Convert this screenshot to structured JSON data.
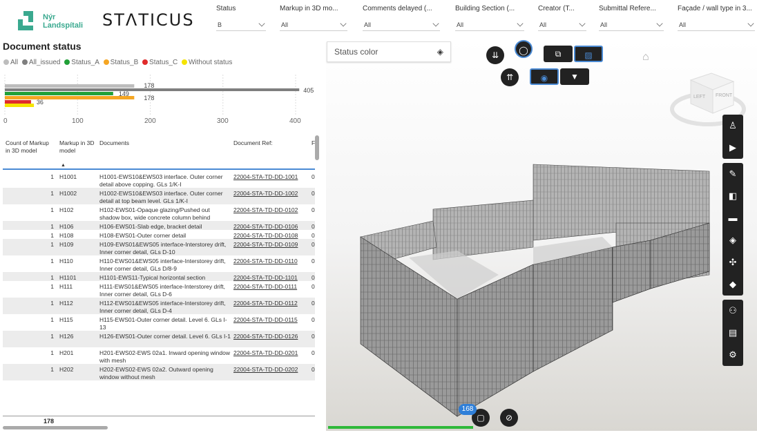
{
  "header": {
    "logo_text_1": "Nýr",
    "logo_text_2": "Landspítali",
    "brand": "STΛTICUS",
    "slicers": [
      {
        "label": "Status",
        "value": "B"
      },
      {
        "label": "Markup in 3D mo...",
        "value": "All"
      },
      {
        "label": "Comments delayed (...",
        "value": "All"
      },
      {
        "label": "Building Section (...",
        "value": "All"
      },
      {
        "label": "Creator (T...",
        "value": "All"
      },
      {
        "label": "Submittal Refere...",
        "value": "All"
      },
      {
        "label": "Façade / wall type in 3...",
        "value": "All"
      }
    ]
  },
  "document_status": {
    "title": "Document status",
    "legend": [
      {
        "label": "All",
        "color": "#bdbdbd"
      },
      {
        "label": "All_issued",
        "color": "#7f7f7f"
      },
      {
        "label": "Status_A",
        "color": "#21a038"
      },
      {
        "label": "Status_B",
        "color": "#f5a623"
      },
      {
        "label": "Status_C",
        "color": "#e02b2b"
      },
      {
        "label": "Without status",
        "color": "#f5e400"
      }
    ]
  },
  "chart_data": {
    "type": "bar",
    "orientation": "horizontal",
    "series": [
      {
        "name": "All",
        "value": 178,
        "color": "#bdbdbd"
      },
      {
        "name": "All_issued",
        "value": 405,
        "color": "#7f7f7f"
      },
      {
        "name": "Status_A",
        "value": 149,
        "color": "#21a038"
      },
      {
        "name": "Status_B",
        "value": 178,
        "color": "#f5a623"
      },
      {
        "name": "Status_C",
        "value": 36,
        "color": "#e02b2b"
      },
      {
        "name": "Without status",
        "value": 40,
        "color": "#f5e400"
      }
    ],
    "data_labels": [
      "178",
      "405",
      "149",
      "178",
      "36"
    ],
    "xlim": [
      0,
      420
    ],
    "x_ticks": [
      "0",
      "100",
      "200",
      "300",
      "400"
    ]
  },
  "table": {
    "headers": [
      "Count of Markup in 3D model",
      "Markup in 3D model",
      "Documents",
      "Document Ref:",
      "F"
    ],
    "rows": [
      {
        "count": "1",
        "markup": "H1001",
        "doc": "H1001-EWS10&EWS03 interface. Outer corner detail above copping. GLs 1/K-I",
        "ref": "22004-STA-TD-DD-1001",
        "f": "0"
      },
      {
        "count": "1",
        "markup": "H1002",
        "doc": "H1002-EWS10&EWS03 interface. Outer corner detail at top beam level. GLs 1/K-I",
        "ref": "22004-STA-TD-DD-1002",
        "f": "0"
      },
      {
        "count": "1",
        "markup": "H102",
        "doc": "H102-EWS01-Opaque glazing/Pushed out shadow box, wide concrete column behind",
        "ref": "22004-STA-TD-DD-0102",
        "f": "0"
      },
      {
        "count": "1",
        "markup": "H106",
        "doc": "H106-EWS01-Slab edge, bracket detail",
        "ref": "22004-STA-TD-DD-0106",
        "f": "0"
      },
      {
        "count": "1",
        "markup": "H108",
        "doc": "H108-EWS01-Outer corner detail",
        "ref": "22004-STA-TD-DD-0108",
        "f": "0"
      },
      {
        "count": "1",
        "markup": "H109",
        "doc": "H109-EWS01&EWS05 interface-Interstorey drift, Inner corner detail, GLs D-10",
        "ref": "22004-STA-TD-DD-0109",
        "f": "0"
      },
      {
        "count": "1",
        "markup": "H110",
        "doc": "H110-EWS01&EWS05 interface-Interstorey drift, Inner corner detail, GLs D/8-9",
        "ref": "22004-STA-TD-DD-0110",
        "f": "0"
      },
      {
        "count": "1",
        "markup": "H1101",
        "doc": "H1101-EWS11-Typical horizontal section",
        "ref": "22004-STA-TD-DD-1101",
        "f": "0"
      },
      {
        "count": "1",
        "markup": "H111",
        "doc": "H111-EWS01&EWS05 interface-Interstorey drift, Inner corner detail, GLs D-6",
        "ref": "22004-STA-TD-DD-0111",
        "f": "0"
      },
      {
        "count": "1",
        "markup": "H112",
        "doc": "H112-EWS01&EWS05 interface-Interstorey drift, Inner corner detail, GLs D-4",
        "ref": "22004-STA-TD-DD-0112",
        "f": "0"
      },
      {
        "count": "1",
        "markup": "H115",
        "doc": "H115-EWS01-Outer corner detail. Level 6. GLs I-13",
        "ref": "22004-STA-TD-DD-0115",
        "f": "0"
      },
      {
        "count": "1",
        "markup": "H126",
        "doc": "H126-EWS01-Outer corner detail. Level 6. GLs I-1",
        "ref": "22004-STA-TD-DD-0126",
        "f": "0"
      },
      {
        "count": "1",
        "markup": "H201",
        "doc": "H201-EWS02-EWS 02a1. Inward opening window with mesh",
        "ref": "22004-STA-TD-DD-0201",
        "f": "0"
      },
      {
        "count": "1",
        "markup": "H202",
        "doc": "H202-EWS02-EWS 02a2. Outward opening window without mesh",
        "ref": "22004-STA-TD-DD-0202",
        "f": "0"
      }
    ],
    "total": "178"
  },
  "viewer": {
    "status_color_label": "Status color",
    "count_badge": "168",
    "progress": 1.0,
    "cube_labels": [
      "LEFT",
      "FRONT"
    ]
  }
}
